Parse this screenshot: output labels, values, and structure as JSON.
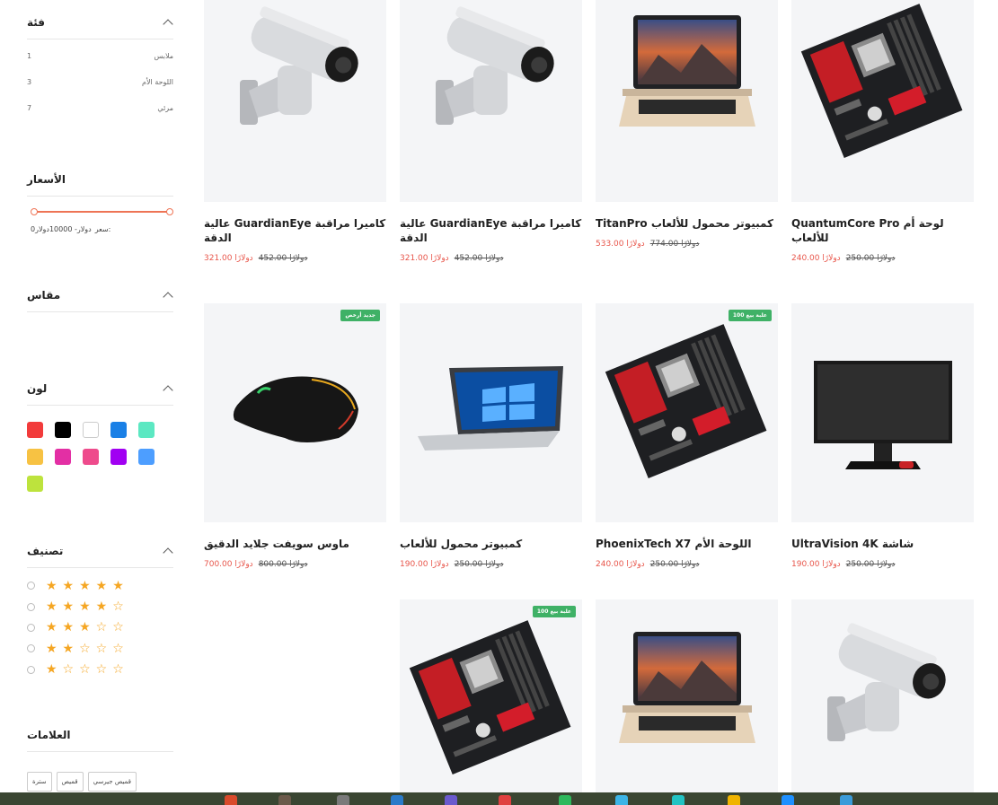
{
  "filters": {
    "category": {
      "title": "فئة",
      "items": [
        {
          "label": "ملابس",
          "count": "1"
        },
        {
          "label": "اللوحة الأم",
          "count": "3"
        },
        {
          "label": "مرئي",
          "count": "7"
        }
      ]
    },
    "prices": {
      "title": "الأسعار",
      "label": "سعر:",
      "range": "0دولار- 10000دولار"
    },
    "size": {
      "title": "مقاس"
    },
    "color": {
      "title": "لون",
      "swatches": [
        "#f23b3b",
        "#000000",
        "#ffffff",
        "#1a80e6",
        "#5ce8c2",
        "#f7c243",
        "#e32fa4",
        "#ee4b8c",
        "#a100f2",
        "#4d9eff",
        "#bde33d"
      ]
    },
    "rating": {
      "title": "تصنيف",
      "rows": [
        {
          "stars": "★★★★★",
          "value": 5
        },
        {
          "stars": "★★★★☆",
          "value": 4
        },
        {
          "stars": "★★★☆☆",
          "value": 3
        },
        {
          "stars": "★★☆☆☆",
          "value": 2
        },
        {
          "stars": "★☆☆☆☆",
          "value": 1
        }
      ]
    },
    "tags": {
      "title": "العلامات",
      "items": [
        "قميص جيرسي",
        "قميص",
        "سترة"
      ]
    }
  },
  "products": [
    {
      "name": "لوحة أم QuantumCore Pro للألعاب",
      "price": "240.00 دولارًا",
      "old_price": "250.00 دولارًا",
      "badge": "",
      "image": "motherboard"
    },
    {
      "name": "كمبيوتر محمول للألعاب TitanPro",
      "price": "533.00 دولارًا",
      "old_price": "774.00 دولارًا",
      "badge": "",
      "image": "laptop-mac"
    },
    {
      "name": "كاميرا مراقبة GuardianEye عالية الدقة",
      "price": "321.00 دولارًا",
      "old_price": "452.00 دولارًا",
      "badge": "",
      "image": "camera"
    },
    {
      "name": "كاميرا مراقبة GuardianEye عالية الدقة",
      "price": "321.00 دولارًا",
      "old_price": "452.00 دولارًا",
      "badge": "",
      "image": "camera"
    },
    {
      "name": "شاشة UltraVision 4K",
      "price": "190.00 دولارًا",
      "old_price": "250.00 دولارًا",
      "badge": "",
      "image": "monitor"
    },
    {
      "name": "اللوحة الأم PhoenixTech X7",
      "price": "240.00 دولارًا",
      "old_price": "250.00 دولارًا",
      "badge": "علبة بيع 100",
      "image": "motherboard"
    },
    {
      "name": "كمبيوتر محمول للألعاب",
      "price": "190.00 دولارًا",
      "old_price": "250.00 دولارًا",
      "badge": "",
      "image": "laptop-win"
    },
    {
      "name": "ماوس سويفت جلايد الدقيق",
      "price": "700.00 دولارًا",
      "old_price": "800.00 دولارًا",
      "badge": "جديد أرخص",
      "image": "mouse"
    },
    {
      "name": "",
      "price": "",
      "old_price": "",
      "badge": "",
      "image": "camera"
    },
    {
      "name": "",
      "price": "",
      "old_price": "",
      "badge": "",
      "image": "laptop-mac"
    },
    {
      "name": "",
      "price": "",
      "old_price": "",
      "badge": "علبة بيع 100",
      "image": "motherboard"
    }
  ],
  "taskbar_icons": [
    "#d94a2b",
    "#6b5a4a",
    "#7a7a7a",
    "#2a7ac9",
    "#6a5acd",
    "#e04040",
    "#2eb85c",
    "#3cb4e6",
    "#22c3c3",
    "#f0b400",
    "#1e90ff",
    "#3a9bd9"
  ]
}
